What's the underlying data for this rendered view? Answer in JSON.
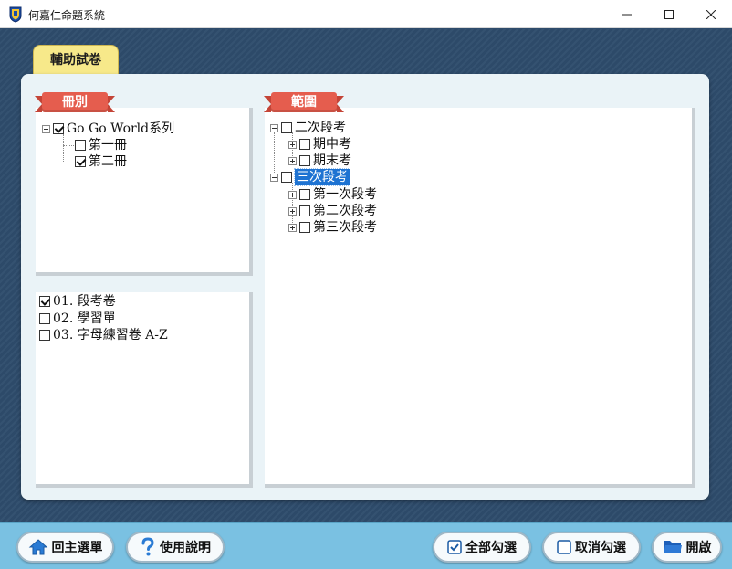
{
  "window": {
    "title": "何嘉仁命題系統"
  },
  "tab": {
    "label": "輔助試卷"
  },
  "books_panel": {
    "header": "冊別",
    "root": {
      "label": "Go Go World系列",
      "checked": true,
      "expanded": true
    },
    "children": [
      {
        "label": "第一冊",
        "checked": false
      },
      {
        "label": "第二冊",
        "checked": true
      }
    ]
  },
  "types_panel": {
    "items": [
      {
        "label": "01. 段考卷",
        "checked": true
      },
      {
        "label": "02. 學習單",
        "checked": false
      },
      {
        "label": "03. 字母練習卷 A-Z",
        "checked": false
      }
    ]
  },
  "range_panel": {
    "header": "範圍",
    "nodes": [
      {
        "label": "二次段考",
        "checked": false,
        "expanded": true,
        "selected": false,
        "children": [
          {
            "label": "期中考",
            "checked": false
          },
          {
            "label": "期末考",
            "checked": false
          }
        ]
      },
      {
        "label": "三次段考",
        "checked": false,
        "expanded": true,
        "selected": true,
        "children": [
          {
            "label": "第一次段考",
            "checked": false
          },
          {
            "label": "第二次段考",
            "checked": false
          },
          {
            "label": "第三次段考",
            "checked": false
          }
        ]
      }
    ]
  },
  "toolbar": {
    "home_label": "回主選單",
    "help_label": "使用說明",
    "select_all_label": "全部勾選",
    "deselect_all_label": "取消勾選",
    "open_label": "開啟"
  },
  "colors": {
    "background": "#2e4c6c",
    "ribbon": "#e55d4e",
    "tab": "#f7e98a",
    "bottom_bar": "#7ac1e2",
    "selection": "#1e73d2"
  }
}
